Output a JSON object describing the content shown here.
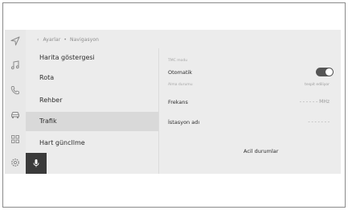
{
  "breadcrumb": {
    "back": "‹",
    "parent": "Ayarlar",
    "separator": "•",
    "current": "Navigasyon"
  },
  "rail": {
    "icons": [
      "navigation-icon",
      "music-icon",
      "phone-icon",
      "car-icon",
      "apps-icon",
      "settings-icon"
    ]
  },
  "menu": {
    "items": [
      {
        "label": "Harita göstergesi",
        "active": false
      },
      {
        "label": "Rota",
        "active": false
      },
      {
        "label": "Rehber",
        "active": false
      },
      {
        "label": "Trafik",
        "active": true
      },
      {
        "label": "Hart güncllme",
        "active": false
      }
    ]
  },
  "panel": {
    "section_label": "TMC modu",
    "otomatik_label": "Otomatik",
    "otomatik_toggle_on": true,
    "status_sub_label": "Alma durumu",
    "status_sub_value": "tespit ediliyor",
    "frekans_label": "Frekans",
    "frekans_value": "- - - - - - MHz",
    "station_label": "İstasyon adı",
    "station_value": "- - - - - - -",
    "status_button": "Acil durumlar"
  },
  "colors": {
    "screen_bg": "#ececec",
    "active_item_bg": "#d9d9d9",
    "toggle_on": "#555555",
    "mic_button_bg": "#3a3a3a"
  }
}
